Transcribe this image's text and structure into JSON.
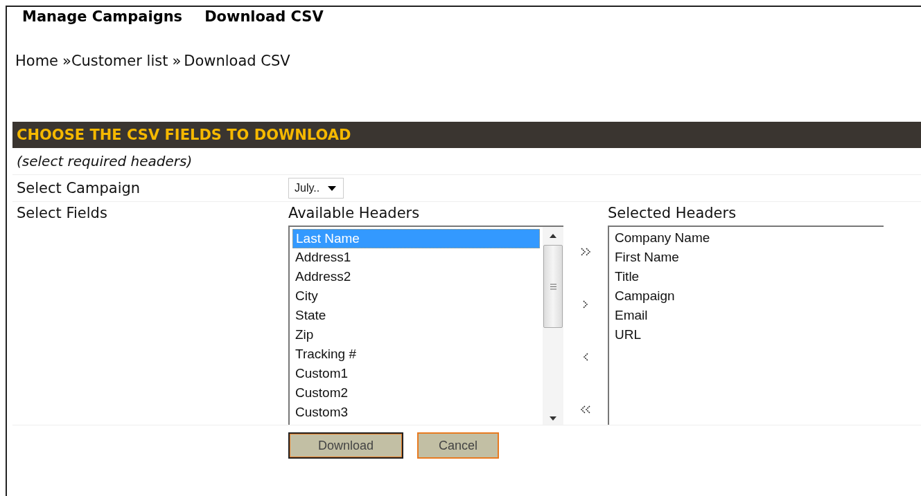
{
  "menu": [
    {
      "label": "Manage Campaigns"
    },
    {
      "label": "Download CSV"
    }
  ],
  "breadcrumb": {
    "links": [
      "Home",
      "Customer list"
    ],
    "current": "Download CSV",
    "separators": [
      "»",
      "»"
    ]
  },
  "section": {
    "title": "CHOOSE THE CSV FIELDS TO DOWNLOAD",
    "hint": "(select required headers)"
  },
  "campaign": {
    "label": "Select Campaign",
    "value": "July.."
  },
  "fields": {
    "label": "Select Fields",
    "available": {
      "title": "Available Headers",
      "items": [
        {
          "label": "Last Name",
          "selected": true
        },
        {
          "label": "Address1",
          "selected": false
        },
        {
          "label": "Address2",
          "selected": false
        },
        {
          "label": "City",
          "selected": false
        },
        {
          "label": "State",
          "selected": false
        },
        {
          "label": "Zip",
          "selected": false
        },
        {
          "label": "Tracking #",
          "selected": false
        },
        {
          "label": "Custom1",
          "selected": false
        },
        {
          "label": "Custom2",
          "selected": false
        },
        {
          "label": "Custom3",
          "selected": false
        }
      ]
    },
    "moves": [
      {
        "kind": "all-right"
      },
      {
        "kind": "right"
      },
      {
        "kind": "left"
      },
      {
        "kind": "all-left"
      }
    ],
    "selected": {
      "title": "Selected Headers",
      "items": [
        {
          "label": "Company Name",
          "selected": false
        },
        {
          "label": "First Name",
          "selected": false
        },
        {
          "label": "Title",
          "selected": false
        },
        {
          "label": "Campaign",
          "selected": false
        },
        {
          "label": "Email",
          "selected": false
        },
        {
          "label": "URL",
          "selected": false
        }
      ]
    }
  },
  "buttons": [
    {
      "label": "Download",
      "focused": true
    },
    {
      "label": "Cancel",
      "focused": false
    }
  ]
}
